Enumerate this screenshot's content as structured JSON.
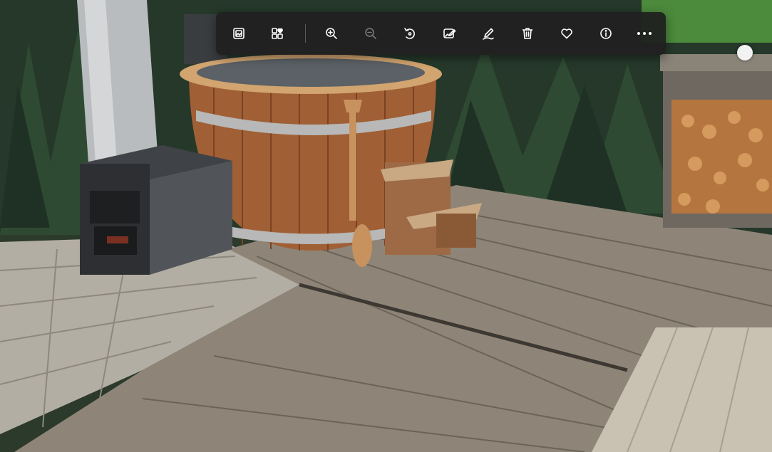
{
  "viewer": {
    "toolbar": {
      "buttons": [
        {
          "id": "view-original",
          "icon": "image-icon"
        },
        {
          "id": "collection",
          "icon": "gallery-heart-icon"
        },
        {
          "id": "zoom-in",
          "icon": "zoom-in-icon"
        },
        {
          "id": "zoom-out",
          "icon": "zoom-out-icon",
          "disabled": true
        },
        {
          "id": "rotate",
          "icon": "rotate-icon"
        },
        {
          "id": "edit-image",
          "icon": "edit-image-icon"
        },
        {
          "id": "draw",
          "icon": "pen-icon"
        },
        {
          "id": "delete",
          "icon": "trash-icon"
        },
        {
          "id": "favorite",
          "icon": "heart-icon"
        },
        {
          "id": "file-info",
          "icon": "info-icon"
        },
        {
          "id": "more",
          "icon": "more-icon"
        }
      ]
    },
    "photo": {
      "icon": "hot-tub-photo"
    },
    "colors": {
      "toolbar_bg": "#202020",
      "icon": "#ffffff",
      "icon_disabled": "#7a7a7a"
    }
  }
}
